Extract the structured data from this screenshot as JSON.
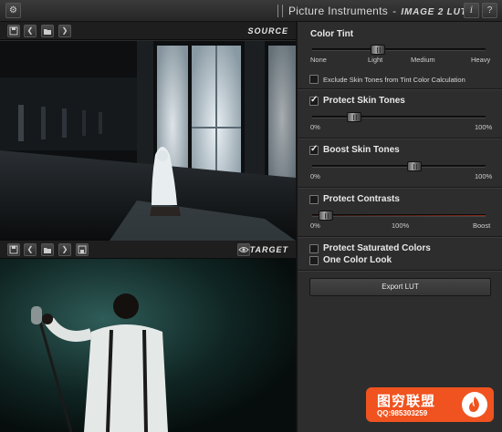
{
  "app": {
    "brand": "Picture Instruments",
    "separator": "-",
    "product": "IMAGE 2 LUT",
    "info_button": "i",
    "menu_button": "?",
    "gear_icon": "gear-icon"
  },
  "source_pane": {
    "label": "SOURCE",
    "buttons": [
      "save-icon",
      "chevron-left-icon",
      "folder-icon",
      "chevron-right-icon"
    ]
  },
  "target_pane": {
    "label": "TARGET",
    "buttons": [
      "save-icon",
      "chevron-left-icon",
      "folder-icon",
      "chevron-right-icon",
      "save-icon"
    ],
    "eye_icon": "eye-icon"
  },
  "color_tint": {
    "title": "Color Tint",
    "value": 0.37,
    "ticks": [
      "None",
      "Light",
      "Medium",
      "Heavy"
    ],
    "exclude_label": "Exclude Skin Tones from Tint Color Calculation",
    "exclude_checked": false
  },
  "protect_skin": {
    "label": "Protect Skin Tones",
    "checked": true,
    "value": 0.22,
    "min_label": "0%",
    "max_label": "100%"
  },
  "boost_skin": {
    "label": "Boost Skin Tones",
    "checked": true,
    "value": 0.6,
    "min_label": "0%",
    "max_label": "100%"
  },
  "protect_contrasts": {
    "label": "Protect Contrasts",
    "checked": false,
    "value": 0.04,
    "ticks": [
      "0%",
      "100%",
      "Boost"
    ]
  },
  "protect_saturated": {
    "label": "Protect Saturated Colors",
    "checked": false
  },
  "one_color": {
    "label": "One Color Look",
    "checked": false
  },
  "export": {
    "label": "Export LUT"
  },
  "watermark": {
    "title": "图穷联盟",
    "qq": "QQ:985303259"
  },
  "colors": {
    "accent_orange": "#f0531f",
    "panel": "#2d2d2d",
    "boost_track": "#8a2a1a"
  }
}
